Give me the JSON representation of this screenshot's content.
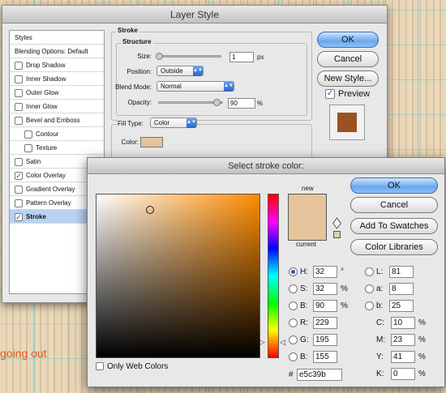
{
  "background": {
    "canvas_text": "going out"
  },
  "layer_style": {
    "title": "Layer Style",
    "styles_header": "Styles",
    "styles": [
      {
        "label": "Blending Options: Default",
        "checkbox": false,
        "checked": false,
        "indent": false,
        "selected": false
      },
      {
        "label": "Drop Shadow",
        "checkbox": true,
        "checked": false,
        "indent": false,
        "selected": false
      },
      {
        "label": "Inner Shadow",
        "checkbox": true,
        "checked": false,
        "indent": false,
        "selected": false
      },
      {
        "label": "Outer Glow",
        "checkbox": true,
        "checked": false,
        "indent": false,
        "selected": false
      },
      {
        "label": "Inner Glow",
        "checkbox": true,
        "checked": false,
        "indent": false,
        "selected": false
      },
      {
        "label": "Bevel and Emboss",
        "checkbox": true,
        "checked": false,
        "indent": false,
        "selected": false
      },
      {
        "label": "Contour",
        "checkbox": true,
        "checked": false,
        "indent": true,
        "selected": false
      },
      {
        "label": "Texture",
        "checkbox": true,
        "checked": false,
        "indent": true,
        "selected": false
      },
      {
        "label": "Satin",
        "checkbox": true,
        "checked": false,
        "indent": false,
        "selected": false
      },
      {
        "label": "Color Overlay",
        "checkbox": true,
        "checked": true,
        "indent": false,
        "selected": false
      },
      {
        "label": "Gradient Overlay",
        "checkbox": true,
        "checked": false,
        "indent": false,
        "selected": false
      },
      {
        "label": "Pattern Overlay",
        "checkbox": true,
        "checked": false,
        "indent": false,
        "selected": false
      },
      {
        "label": "Stroke",
        "checkbox": true,
        "checked": true,
        "indent": false,
        "selected": true
      }
    ],
    "stroke": {
      "header": "Stroke",
      "structure": "Structure",
      "size_label": "Size:",
      "size_value": "1",
      "size_unit": "px",
      "position_label": "Position:",
      "position_value": "Outside",
      "blend_label": "Blend Mode:",
      "blend_value": "Normal",
      "opacity_label": "Opacity:",
      "opacity_value": "90",
      "opacity_unit": "%",
      "fill_type_label": "Fill Type:",
      "fill_type_value": "Color",
      "color_label": "Color:",
      "color_swatch": "#e5c39b"
    },
    "buttons": {
      "ok": "OK",
      "cancel": "Cancel",
      "new_style": "New Style..."
    },
    "preview_label": "Preview",
    "preview_checked": true,
    "preview_color": "#9a5222"
  },
  "color_picker": {
    "title": "Select stroke color:",
    "new_label": "new",
    "current_label": "current",
    "new_color": "#e5c39b",
    "current_color": "#e5c39b",
    "hue_color": "#ff8c00",
    "only_web_colors": "Only Web Colors",
    "buttons": {
      "ok": "OK",
      "cancel": "Cancel",
      "add_swatches": "Add To Swatches",
      "color_libraries": "Color Libraries"
    },
    "hsb": [
      {
        "label": "H:",
        "value": "32",
        "unit": "°",
        "selected": true
      },
      {
        "label": "S:",
        "value": "32",
        "unit": "%",
        "selected": false
      },
      {
        "label": "B:",
        "value": "90",
        "unit": "%",
        "selected": false
      }
    ],
    "rgb": [
      {
        "label": "R:",
        "value": "229"
      },
      {
        "label": "G:",
        "value": "195"
      },
      {
        "label": "B:",
        "value": "155"
      }
    ],
    "lab": [
      {
        "label": "L:",
        "value": "81"
      },
      {
        "label": "a:",
        "value": "8"
      },
      {
        "label": "b:",
        "value": "25"
      }
    ],
    "cmyk": [
      {
        "label": "C:",
        "value": "10",
        "unit": "%"
      },
      {
        "label": "M:",
        "value": "23",
        "unit": "%"
      },
      {
        "label": "Y:",
        "value": "41",
        "unit": "%"
      },
      {
        "label": "K:",
        "value": "0",
        "unit": "%"
      }
    ],
    "hex_label": "#",
    "hex_value": "e5c39b"
  }
}
